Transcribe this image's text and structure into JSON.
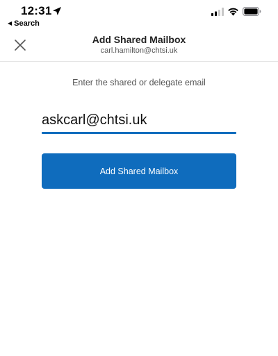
{
  "status_bar": {
    "time": "12:31",
    "back_label": "Search"
  },
  "header": {
    "title": "Add Shared Mailbox",
    "subtitle": "carl.hamilton@chtsi.uk"
  },
  "form": {
    "prompt": "Enter the shared or delegate email",
    "email_value": "askcarl@chtsi.uk",
    "submit_label": "Add Shared Mailbox"
  },
  "colors": {
    "accent": "#0f6cbd"
  },
  "icons": [
    "location-arrow-icon",
    "back-triangle-icon",
    "signal-icon",
    "wifi-icon",
    "battery-icon",
    "close-icon"
  ]
}
